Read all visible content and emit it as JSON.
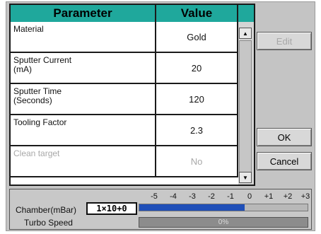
{
  "table": {
    "header_parameter": "Parameter",
    "header_value": "Value",
    "rows": [
      {
        "parameter": "Material",
        "value": "Gold"
      },
      {
        "parameter": "Sputter Current\n(mA)",
        "value": "20"
      },
      {
        "parameter": "Sputter Time\n(Seconds)",
        "value": "120"
      },
      {
        "parameter": "Tooling Factor",
        "value": "2.3"
      },
      {
        "parameter": "Clean target",
        "value": "No"
      }
    ]
  },
  "buttons": {
    "edit": "Edit",
    "ok": "OK",
    "cancel": "Cancel"
  },
  "status": {
    "chamber_label": "Chamber(mBar)",
    "chamber_value": "1×10+0",
    "scale_ticks": [
      "-5",
      "-4",
      "-3",
      "-2",
      "-1",
      "0",
      "+1",
      "+2",
      "+3"
    ],
    "pressure_exponent": 0,
    "turbo_label": "Turbo Speed",
    "turbo_value": "0%",
    "turbo_fraction": 0
  },
  "colors": {
    "header": "#1fa89c",
    "pressure_fill": "#1f4fb8"
  }
}
